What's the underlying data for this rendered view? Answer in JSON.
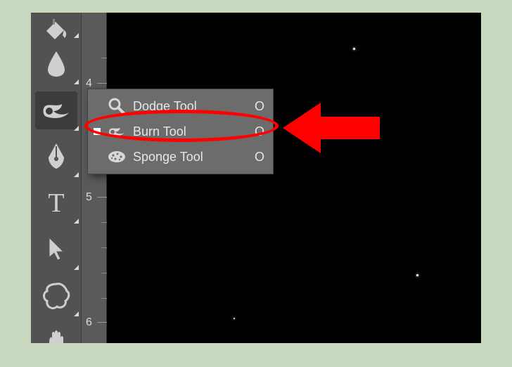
{
  "flyout": {
    "items": [
      {
        "label": "Dodge Tool",
        "shortcut": "O",
        "icon": "dodge-icon",
        "current": false
      },
      {
        "label": "Burn Tool",
        "shortcut": "O",
        "icon": "burn-icon",
        "current": true
      },
      {
        "label": "Sponge Tool",
        "shortcut": "O",
        "icon": "sponge-icon",
        "current": false
      }
    ]
  },
  "ruler": {
    "labels": [
      "4",
      "5",
      "6"
    ]
  },
  "toolbar": {
    "tools": [
      {
        "name": "paint-bucket-tool",
        "icon": "paint-bucket-icon"
      },
      {
        "name": "blur-tool",
        "icon": "droplet-icon"
      },
      {
        "name": "burn-tool",
        "icon": "burn-icon",
        "selected": true
      },
      {
        "name": "pen-tool",
        "icon": "pen-icon"
      },
      {
        "name": "type-tool",
        "icon": "type-icon"
      },
      {
        "name": "path-select-tool",
        "icon": "cursor-icon"
      },
      {
        "name": "shape-tool",
        "icon": "blob-icon"
      },
      {
        "name": "hand-tool",
        "icon": "hand-icon"
      }
    ]
  },
  "annotation": {
    "highlight_color": "#ff0000",
    "arrow_color": "#ff0000"
  }
}
